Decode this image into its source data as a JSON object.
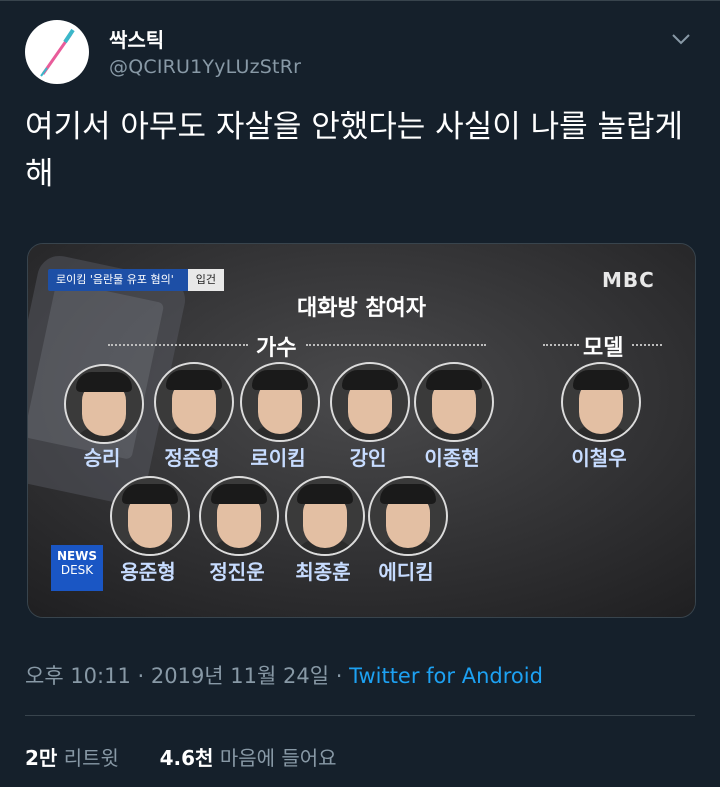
{
  "author": {
    "display_name": "싹스틱",
    "handle": "@QCIRU1YyLUzStRr"
  },
  "tweet": {
    "text": "여기서 아무도 자살을 안했다는 사실이 나를 놀랍게해",
    "timestamp": "오후 10:11 · 2019년 11월 24일 · ",
    "source": "Twitter for Android"
  },
  "media": {
    "news_chip": "로이킴 '음란물 유포 혐의'",
    "news_chip_suffix": "입건",
    "broadcaster": "MBC",
    "title": "대화방 참여자",
    "section_singer": "가수",
    "section_model": "모델",
    "newsdesk_line1": "NEWS",
    "newsdesk_line2": "DESK",
    "singers_row1": [
      "승리",
      "정준영",
      "로이킴",
      "강인",
      "이종현"
    ],
    "singers_row2": [
      "용준형",
      "정진운",
      "최종훈",
      "에디킴"
    ],
    "model": "이철우"
  },
  "stats": {
    "retweets_count": "2만",
    "retweets_label": "리트윗",
    "likes_count": "4.6천",
    "likes_label": "마음에 들어요"
  },
  "colors": {
    "background": "#15202b",
    "secondary_text": "#8899a6",
    "link": "#1da1f2",
    "border": "#38444d"
  }
}
